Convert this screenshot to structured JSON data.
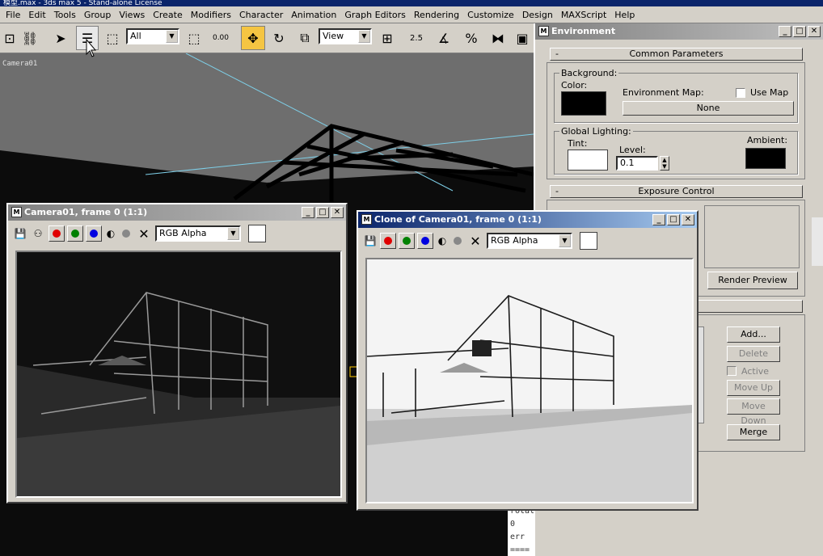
{
  "window_title": "模型.max - 3ds max 5 - Stand-alone License",
  "menu": [
    "File",
    "Edit",
    "Tools",
    "Group",
    "Views",
    "Create",
    "Modifiers",
    "Character",
    "Animation",
    "Graph Editors",
    "Rendering",
    "Customize",
    "Design",
    "MAXScript",
    "Help"
  ],
  "toolbar": {
    "selection_filter": "All",
    "ref_coord": "View",
    "snap_label": "2.5",
    "spinner_snap": "0.00"
  },
  "viewport": {
    "label": "Camera01"
  },
  "environment": {
    "title": "Environment",
    "common_params": "Common Parameters",
    "background_group": "Background:",
    "color_label": "Color:",
    "env_map_label": "Environment Map:",
    "use_map_label": "Use Map",
    "none_button": "None",
    "global_lighting_group": "Global Lighting:",
    "tint_label": "Tint:",
    "level_label": "Level:",
    "level_value": "0.1",
    "ambient_label": "Ambient:",
    "exposure_control": "Exposure Control",
    "render_preview": "Render Preview",
    "add_button": "Add...",
    "delete_button": "Delete",
    "active_label": "Active",
    "move_up_button": "Move Up",
    "move_down_button": "Move Down",
    "merge_button": "Merge",
    "rollout_minus": "-",
    "background_color": "#000000",
    "tint_color": "#ffffff",
    "ambient_color": "#000000"
  },
  "vfb1": {
    "title": "Camera01, frame 0 (1:1)",
    "channel": "RGB Alpha"
  },
  "vfb2": {
    "title": "Clone of Camera01, frame 0 (1:1)",
    "channel": "RGB Alpha"
  },
  "maxscript_listener": {
    "line1": "rotat",
    "line2": "0 err",
    "line3": "===="
  },
  "colors": {
    "title_active": "#0a246a",
    "title_inactive": "#808080",
    "chrome": "#d4d0c8",
    "accent_yellow": "#f5c542"
  }
}
